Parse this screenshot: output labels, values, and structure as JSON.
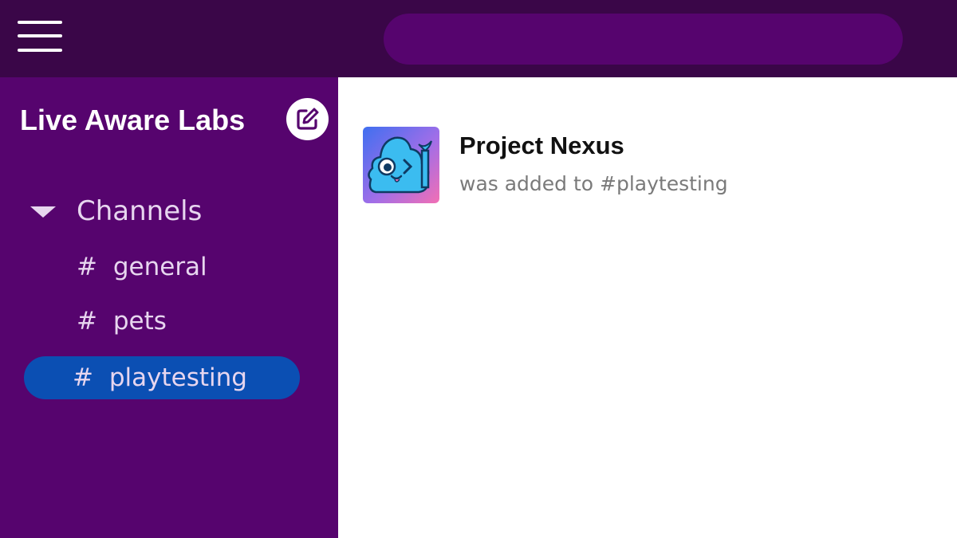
{
  "workspace": {
    "name": "Live Aware Labs"
  },
  "search": {
    "placeholder": "",
    "value": ""
  },
  "channels": {
    "header": "Channels",
    "items": [
      {
        "hash": "#",
        "label": "general",
        "selected": false
      },
      {
        "hash": "#",
        "label": "pets",
        "selected": false
      },
      {
        "hash": "#",
        "label": "playtesting",
        "selected": true
      }
    ]
  },
  "message": {
    "author": "Project Nexus",
    "text": "was added to #playtesting"
  },
  "colors": {
    "topbar": "#3a0648",
    "sidebar": "#56046e",
    "search_bg": "#56046e",
    "selected_channel": "#0b4fb3",
    "sidebar_text": "#e7d6ef"
  },
  "icons": {
    "menu": "hamburger-menu-icon",
    "compose": "compose-icon",
    "caret": "caret-down-icon",
    "avatar": "blob-mascot-avatar"
  }
}
